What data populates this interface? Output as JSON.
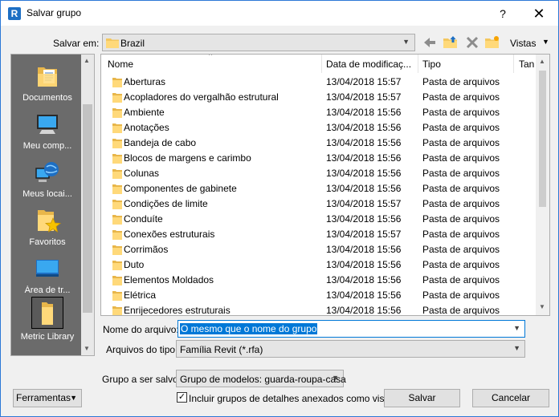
{
  "window": {
    "title": "Salvar grupo",
    "help": "?",
    "close": "✕",
    "app_icon": "R"
  },
  "toolbar": {
    "save_in_label": "Salvar em:",
    "save_in_value": "Brazil",
    "views_label": "Vistas"
  },
  "places": [
    {
      "label": "Documentos",
      "icon": "documents-icon"
    },
    {
      "label": "Meu comp...",
      "icon": "computer-icon"
    },
    {
      "label": "Meus locai...",
      "icon": "network-places-icon"
    },
    {
      "label": "Favoritos",
      "icon": "favorites-icon"
    },
    {
      "label": "Área de tr...",
      "icon": "desktop-icon"
    },
    {
      "label": "Metric Library",
      "icon": "folder-icon"
    }
  ],
  "columns": {
    "name": "Nome",
    "date": "Data de modificaç...",
    "type": "Tipo",
    "size": "Tan"
  },
  "files": [
    {
      "name": "Aberturas",
      "date": "13/04/2018 15:57",
      "type": "Pasta de arquivos"
    },
    {
      "name": "Acopladores do vergalhão estrutural",
      "date": "13/04/2018 15:57",
      "type": "Pasta de arquivos"
    },
    {
      "name": "Ambiente",
      "date": "13/04/2018 15:56",
      "type": "Pasta de arquivos"
    },
    {
      "name": "Anotações",
      "date": "13/04/2018 15:56",
      "type": "Pasta de arquivos"
    },
    {
      "name": "Bandeja de cabo",
      "date": "13/04/2018 15:56",
      "type": "Pasta de arquivos"
    },
    {
      "name": "Blocos de margens e carimbo",
      "date": "13/04/2018 15:56",
      "type": "Pasta de arquivos"
    },
    {
      "name": "Colunas",
      "date": "13/04/2018 15:56",
      "type": "Pasta de arquivos"
    },
    {
      "name": "Componentes de gabinete",
      "date": "13/04/2018 15:56",
      "type": "Pasta de arquivos"
    },
    {
      "name": "Condições de limite",
      "date": "13/04/2018 15:57",
      "type": "Pasta de arquivos"
    },
    {
      "name": "Conduíte",
      "date": "13/04/2018 15:56",
      "type": "Pasta de arquivos"
    },
    {
      "name": "Conexões estruturais",
      "date": "13/04/2018 15:57",
      "type": "Pasta de arquivos"
    },
    {
      "name": "Corrimãos",
      "date": "13/04/2018 15:56",
      "type": "Pasta de arquivos"
    },
    {
      "name": "Duto",
      "date": "13/04/2018 15:56",
      "type": "Pasta de arquivos"
    },
    {
      "name": "Elementos Moldados",
      "date": "13/04/2018 15:56",
      "type": "Pasta de arquivos"
    },
    {
      "name": "Elétrica",
      "date": "13/04/2018 15:56",
      "type": "Pasta de arquivos"
    },
    {
      "name": "Enrijecedores estruturais",
      "date": "13/04/2018 15:56",
      "type": "Pasta de arquivos"
    }
  ],
  "form": {
    "filename_label": "Nome do arquivo:",
    "filename_value": "O mesmo que o nome do grupo",
    "filetype_label": "Arquivos do tipo:",
    "filetype_value": "Família Revit  (*.rfa)",
    "group_label": "Grupo a ser salvo:",
    "group_value": "Grupo de modelos: guarda-roupa-casa",
    "include_label": "Incluir grupos de detalhes anexados como vistas",
    "include_checked": "✓",
    "tools_label": "Ferramentas",
    "save_label": "Salvar",
    "cancel_label": "Cancelar"
  }
}
